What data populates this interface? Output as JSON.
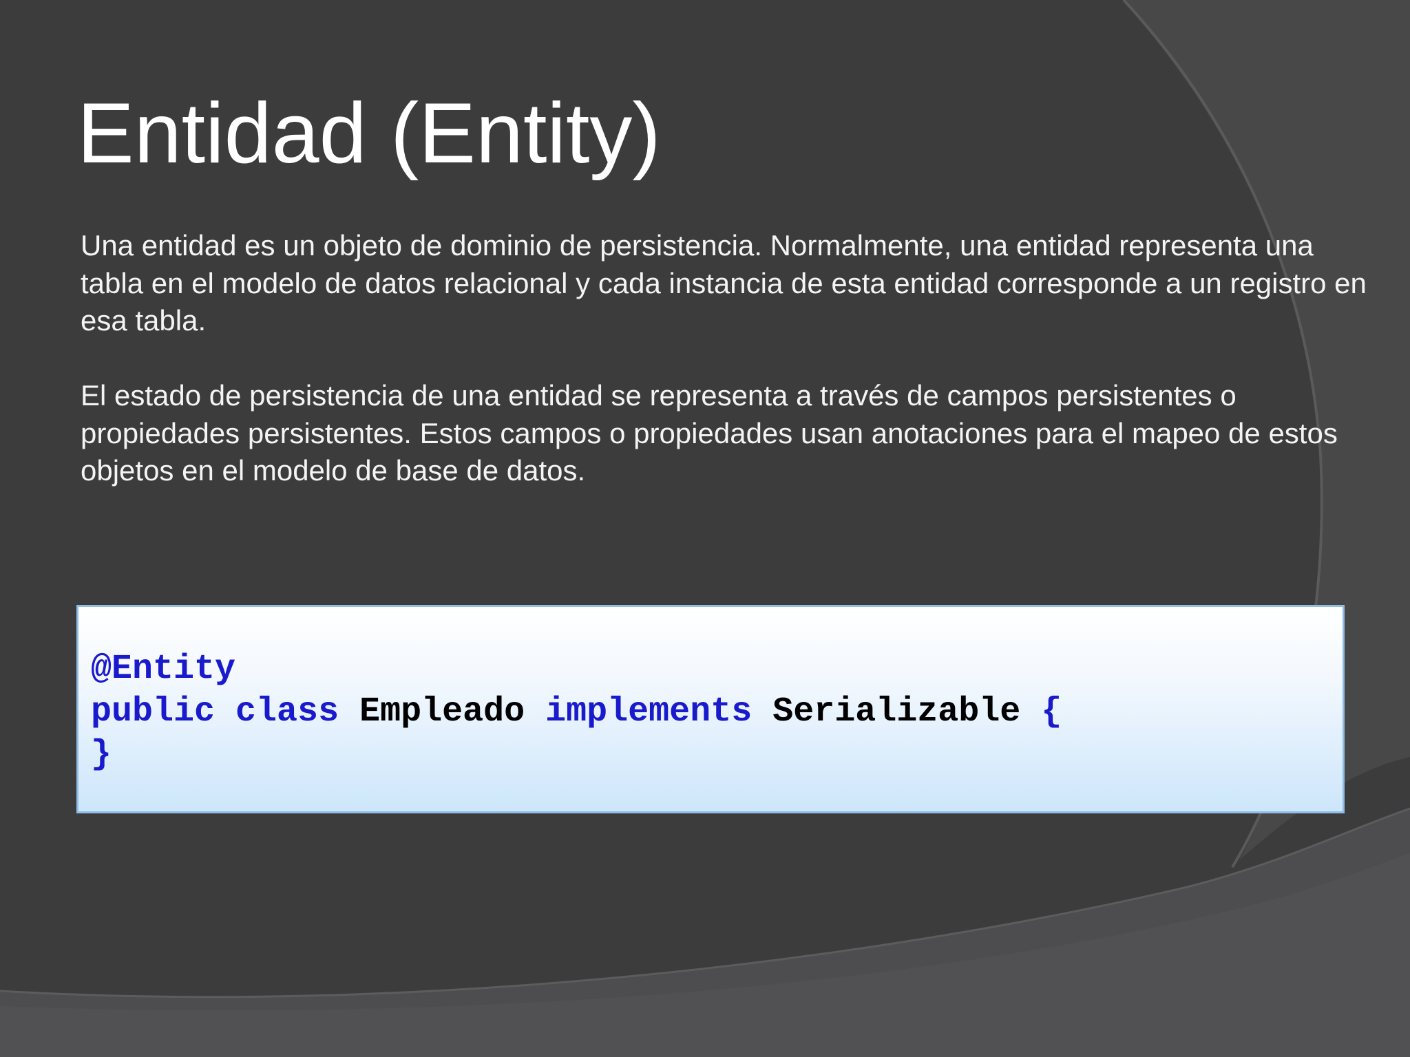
{
  "slide": {
    "title": "Entidad (Entity)",
    "paragraphs": [
      "Una entidad es un objeto de dominio de persistencia. Normalmente, una entidad representa una tabla en el modelo de datos relacional y cada instancia de esta entidad corresponde a un registro en esa tabla.",
      "El estado de persistencia de una entidad se representa a través de campos persistentes o propiedades persistentes. Estos campos o propiedades usan anotaciones para el mapeo de estos objetos en el modelo de base de datos."
    ],
    "code": {
      "annotation": "@Entity",
      "kw_public": "public",
      "kw_class": "class",
      "class_name": "Empleado",
      "kw_implements": "implements",
      "interface_name": "Serializable",
      "open_brace": "{",
      "close_brace": "}"
    }
  },
  "colors": {
    "background": "#3c3c3d",
    "title_text": "#ffffff",
    "body_text": "#f4f4f4",
    "code_keyword": "#1a1acd",
    "code_identifier": "#000000",
    "code_box_border": "#8fbde6"
  }
}
